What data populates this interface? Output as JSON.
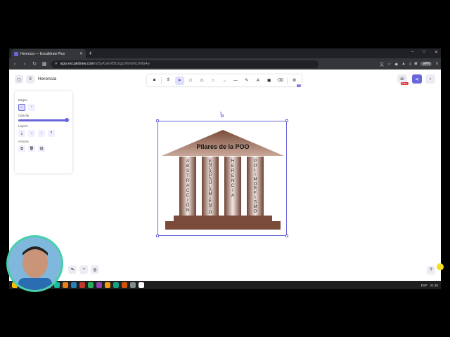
{
  "browser": {
    "tab_title": "Herencia — Excalidraw Plus",
    "new_tab": "+",
    "url_host": "app.excalidraw.com",
    "url_path": "/s/5yKoEXBD2gU/6mdXc6NbAe",
    "vpn_label": "VPN",
    "controls": {
      "minimize": "–",
      "maximize": "□",
      "close": "✕"
    }
  },
  "app": {
    "document_name": "Herencia",
    "new_badge": "New",
    "toolbar_badge": "72",
    "zero_label": "0"
  },
  "panel": {
    "edges_label": "Edges",
    "opacity_label": "Opacity",
    "opacity_value": 100,
    "layers_label": "Layers",
    "actions_label": "Actions"
  },
  "drawing": {
    "title": "Pilares de la POO",
    "columns": [
      "ABSTRACCIÓN",
      "ENCAPSULAMIENTO",
      "HERENCIA",
      "POLIMORFISMO"
    ],
    "roof_color": "#8b5a4a",
    "column_color": "#9a6a5a",
    "base_color": "#7a4b3a"
  },
  "taskbar": {
    "lang": "ESP",
    "time": "21:35"
  },
  "colors": {
    "accent": "#6965db",
    "webcam_ring": "#48d1a8"
  }
}
